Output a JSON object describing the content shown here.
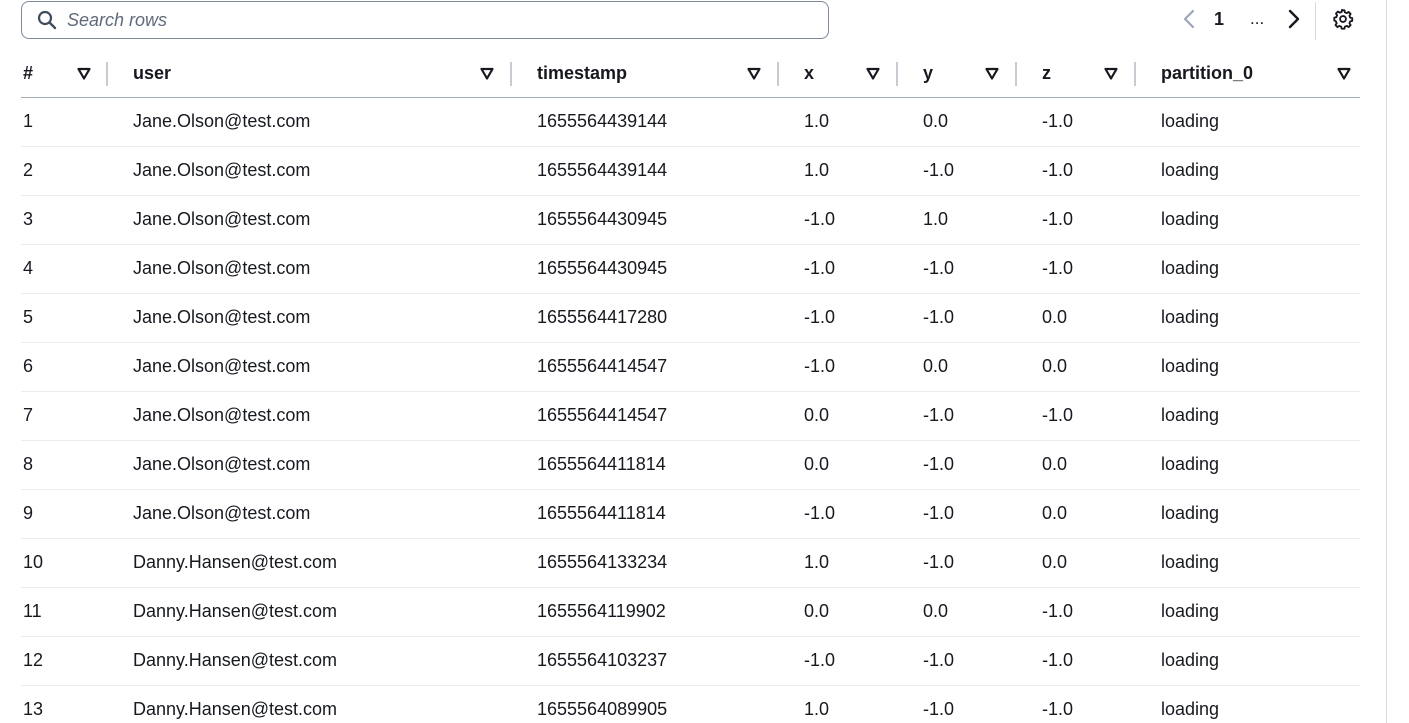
{
  "search": {
    "placeholder": "Search rows",
    "value": ""
  },
  "pagination": {
    "current_page": "1",
    "ellipsis": "..."
  },
  "icons": {
    "search": "search-icon",
    "prev": "chevron-left-icon",
    "next": "chevron-right-icon",
    "settings": "gear-icon",
    "sort": "filter-triangle-icon"
  },
  "colors": {
    "text": "#16191f",
    "border": "#7d8998",
    "muted": "#5f6b7a",
    "row_divider": "#e9ebed"
  },
  "table": {
    "columns": [
      {
        "key": "index",
        "label": "#"
      },
      {
        "key": "user",
        "label": "user"
      },
      {
        "key": "timestamp",
        "label": "timestamp"
      },
      {
        "key": "x",
        "label": "x"
      },
      {
        "key": "y",
        "label": "y"
      },
      {
        "key": "z",
        "label": "z"
      },
      {
        "key": "partition_0",
        "label": "partition_0"
      }
    ],
    "rows": [
      [
        "1",
        "Jane.Olson@test.com",
        "1655564439144",
        "1.0",
        "0.0",
        "-1.0",
        "loading"
      ],
      [
        "2",
        "Jane.Olson@test.com",
        "1655564439144",
        "1.0",
        "-1.0",
        "-1.0",
        "loading"
      ],
      [
        "3",
        "Jane.Olson@test.com",
        "1655564430945",
        "-1.0",
        "1.0",
        "-1.0",
        "loading"
      ],
      [
        "4",
        "Jane.Olson@test.com",
        "1655564430945",
        "-1.0",
        "-1.0",
        "-1.0",
        "loading"
      ],
      [
        "5",
        "Jane.Olson@test.com",
        "1655564417280",
        "-1.0",
        "-1.0",
        "0.0",
        "loading"
      ],
      [
        "6",
        "Jane.Olson@test.com",
        "1655564414547",
        "-1.0",
        "0.0",
        "0.0",
        "loading"
      ],
      [
        "7",
        "Jane.Olson@test.com",
        "1655564414547",
        "0.0",
        "-1.0",
        "-1.0",
        "loading"
      ],
      [
        "8",
        "Jane.Olson@test.com",
        "1655564411814",
        "0.0",
        "-1.0",
        "0.0",
        "loading"
      ],
      [
        "9",
        "Jane.Olson@test.com",
        "1655564411814",
        "-1.0",
        "-1.0",
        "0.0",
        "loading"
      ],
      [
        "10",
        "Danny.Hansen@test.com",
        "1655564133234",
        "1.0",
        "-1.0",
        "0.0",
        "loading"
      ],
      [
        "11",
        "Danny.Hansen@test.com",
        "1655564119902",
        "0.0",
        "0.0",
        "-1.0",
        "loading"
      ],
      [
        "12",
        "Danny.Hansen@test.com",
        "1655564103237",
        "-1.0",
        "-1.0",
        "-1.0",
        "loading"
      ],
      [
        "13",
        "Danny.Hansen@test.com",
        "1655564089905",
        "1.0",
        "-1.0",
        "-1.0",
        "loading"
      ]
    ]
  }
}
